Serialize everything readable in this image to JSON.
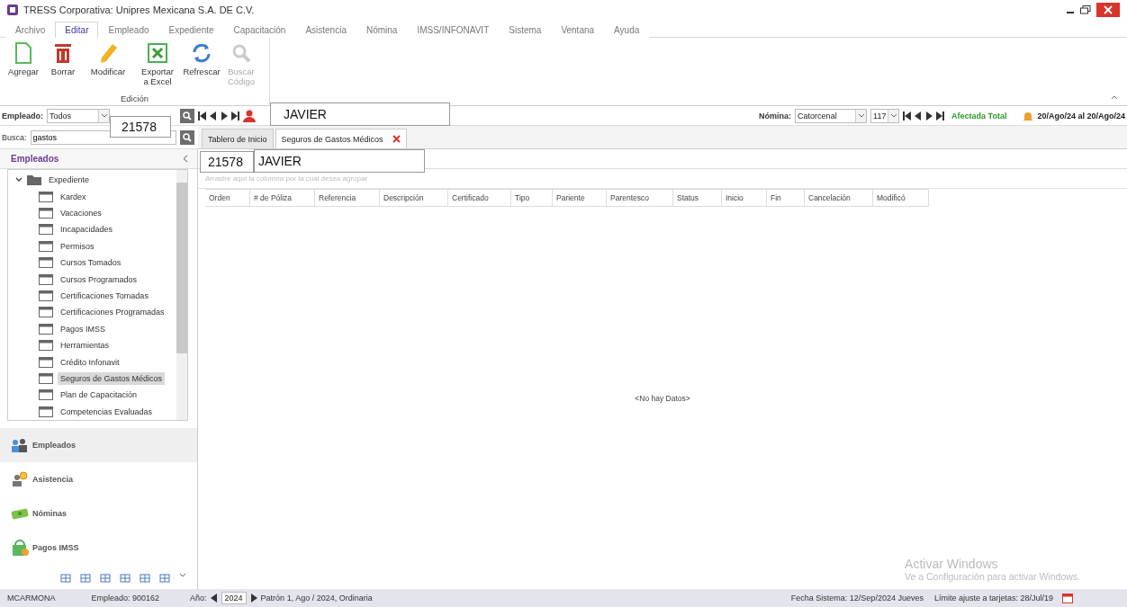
{
  "window": {
    "title": "TRESS Corporativa: Unipres Mexicana S.A. DE C.V."
  },
  "menu_tabs": [
    {
      "label": "Archivo",
      "selected": false
    },
    {
      "label": "Editar",
      "selected": true
    },
    {
      "label": "Empleado",
      "selected": false
    },
    {
      "label": "Expediente",
      "selected": false
    },
    {
      "label": "Capacitación",
      "selected": false
    },
    {
      "label": "Asistencia",
      "selected": false
    },
    {
      "label": "Nómina",
      "selected": false
    },
    {
      "label": "IMSS/INFONAVIT",
      "selected": false
    },
    {
      "label": "Sistema",
      "selected": false
    },
    {
      "label": "Ventana",
      "selected": false
    },
    {
      "label": "Ayuda",
      "selected": false
    }
  ],
  "ribbon": {
    "group_label": "Edición",
    "buttons": [
      {
        "label": "Agregar",
        "kind": "new",
        "disabled": false
      },
      {
        "label": "Borrar",
        "kind": "delete",
        "disabled": false
      },
      {
        "label": "Modificar",
        "kind": "edit",
        "disabled": false
      },
      {
        "label": "Exportar a Excel",
        "kind": "excel",
        "disabled": false
      },
      {
        "label": "Refrescar",
        "kind": "refresh",
        "disabled": false
      },
      {
        "label": "Buscar Código",
        "kind": "search",
        "disabled": true
      }
    ]
  },
  "employee_bar": {
    "label": "Empleado:",
    "filter": "Todos",
    "payroll_label": "Nómina:",
    "payroll_type": "Catorcenal",
    "period": "117",
    "status": "Afectada Total",
    "date_range": "20/Ago/24 al 20/Ago/24"
  },
  "search": {
    "label": "Busca:",
    "value": "gastos"
  },
  "sidebar": {
    "title": "Empleados",
    "tree": [
      {
        "label": "Expediente",
        "expanded": true,
        "children": [
          {
            "label": "Kardex",
            "selected": false
          },
          {
            "label": "Vacaciones",
            "selected": false
          },
          {
            "label": "Incapacidades",
            "selected": false
          },
          {
            "label": "Permisos",
            "selected": false
          },
          {
            "label": "Cursos Tomados",
            "selected": false
          },
          {
            "label": "Cursos Programados",
            "selected": false
          },
          {
            "label": "Certificaciones Tomadas",
            "selected": false
          },
          {
            "label": "Certificaciones Programadas",
            "selected": false
          },
          {
            "label": "Pagos IMSS",
            "selected": false
          },
          {
            "label": "Herramientas",
            "selected": false
          },
          {
            "label": "Crédito Infonavit",
            "selected": false
          },
          {
            "label": "Seguros de Gastos Médicos",
            "selected": true
          },
          {
            "label": "Plan de Capacitación",
            "selected": false
          },
          {
            "label": "Competencias Evaluadas",
            "selected": false
          }
        ]
      }
    ],
    "groups": [
      {
        "label": "Empleados",
        "kind": "employees",
        "selected": true
      },
      {
        "label": "Asistencia",
        "kind": "attendance",
        "selected": false
      },
      {
        "label": "Nóminas",
        "kind": "payroll",
        "selected": false
      },
      {
        "label": "Pagos IMSS",
        "kind": "imss",
        "selected": false
      }
    ]
  },
  "doc_tabs": [
    {
      "label": "Tablero de Inicio",
      "selected": false,
      "closable": false
    },
    {
      "label": "Seguros de Gastos Médicos",
      "selected": true,
      "closable": true
    }
  ],
  "grid": {
    "group_hint": "Arrastre aquí la columna por la cual desea agrupar",
    "columns": [
      "Orden",
      "# de Póliza",
      "Referencia",
      "Descripción",
      "Certificado",
      "Tipo",
      "Pariente",
      "Parentesco",
      "Status",
      "Inicio",
      "Fin",
      "Cancelación",
      "Modificó"
    ],
    "empty_text": "<No hay Datos>"
  },
  "toolbar_overlay": {
    "id": "21578",
    "name": "JAVIER"
  },
  "grid_overlay": {
    "id": "21578",
    "name": "JAVIER"
  },
  "watermark": {
    "title": "Activar Windows",
    "subtitle": "Ve a Configuración para activar Windows."
  },
  "status_bar": {
    "user": "MCARMONA",
    "employee": "Empleado: 900162",
    "year_label": "Año:",
    "year": "2024",
    "period": "Patrón 1, Ago / 2024, Ordinaria",
    "system_date": "Fecha Sistema:  12/Sep/2024  Jueves",
    "limit": "Límite ajuste a tarjetas:  28/Jul/19"
  }
}
